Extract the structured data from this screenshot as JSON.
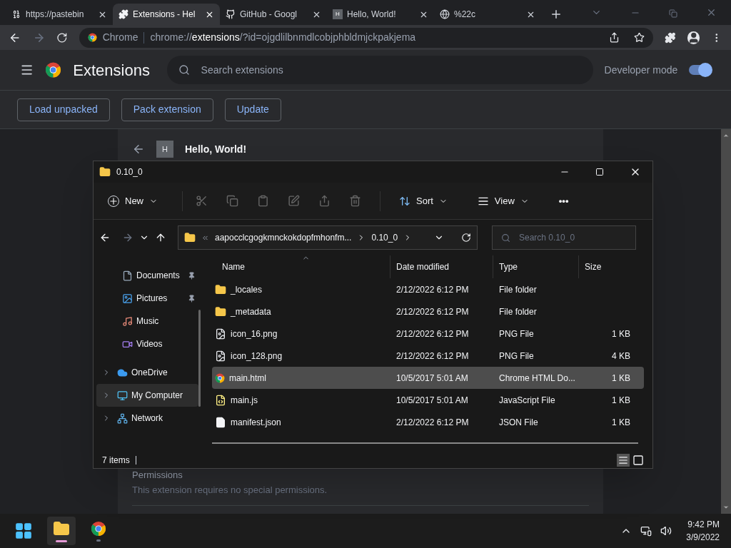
{
  "tabs": [
    {
      "kind": "binary",
      "title": "https://pastebin",
      "selected": false
    },
    {
      "kind": "puzzle",
      "title": "Extensions - Hel",
      "selected": true
    },
    {
      "kind": "github",
      "title": "GitHub - Googl",
      "selected": false
    },
    {
      "kind": "letter",
      "badge": "H",
      "title": "Hello, World!",
      "selected": false
    },
    {
      "kind": "globe",
      "title": "%22c",
      "selected": false
    }
  ],
  "omnibox": {
    "chip": "Chrome",
    "url_prefix": "chrome://",
    "url_host": "extensions",
    "url_rest": "/?id=ojgdlilbnmdlcobjphbldmjckpakjema"
  },
  "extensions_header": {
    "title": "Extensions",
    "search_placeholder": "Search extensions",
    "developer_mode_label": "Developer mode",
    "developer_mode_on": true
  },
  "dev_buttons": [
    "Load unpacked",
    "Pack extension",
    "Update"
  ],
  "extension_card": {
    "badge": "H",
    "name": "Hello, World!",
    "section_title": "Permissions",
    "section_text": "This extension requires no special permissions."
  },
  "explorer": {
    "title": "0.10_0",
    "commands": [
      {
        "kind": "new",
        "label": "New"
      },
      {
        "kind": "cut"
      },
      {
        "kind": "copy"
      },
      {
        "kind": "paste"
      },
      {
        "kind": "rename"
      },
      {
        "kind": "share"
      },
      {
        "kind": "delete"
      },
      {
        "kind": "sort",
        "label": "Sort"
      },
      {
        "kind": "view",
        "label": "View"
      },
      {
        "kind": "more",
        "label": "•••"
      }
    ],
    "breadcrumb": [
      "aapocclcgogkmnckokdopfmhonfm...",
      "0.10_0"
    ],
    "search_placeholder": "Search 0.10_0",
    "nav": [
      {
        "kind": "documents",
        "label": "Documents",
        "pinned": true,
        "expandable": false,
        "selected": false
      },
      {
        "kind": "pictures",
        "label": "Pictures",
        "pinned": true,
        "expandable": false,
        "selected": false
      },
      {
        "kind": "music",
        "label": "Music",
        "pinned": false,
        "expandable": false,
        "selected": false
      },
      {
        "kind": "videos",
        "label": "Videos",
        "pinned": false,
        "expandable": false,
        "selected": false
      },
      {
        "kind": "onedrive",
        "label": "OneDrive",
        "pinned": false,
        "expandable": true,
        "selected": false
      },
      {
        "kind": "computer",
        "label": "My Computer",
        "pinned": false,
        "expandable": true,
        "selected": true
      },
      {
        "kind": "network",
        "label": "Network",
        "pinned": false,
        "expandable": true,
        "selected": false
      }
    ],
    "columns": [
      "Name",
      "Date modified",
      "Type",
      "Size"
    ],
    "rows": [
      {
        "kind": "folder",
        "name": "_locales",
        "date": "2/12/2022 6:12 PM",
        "type": "File folder",
        "selected": false
      },
      {
        "kind": "folder",
        "name": "_metadata",
        "date": "2/12/2022 6:12 PM",
        "type": "File folder",
        "selected": false
      },
      {
        "kind": "image",
        "name": "icon_16.png",
        "date": "2/12/2022 6:12 PM",
        "type": "PNG File",
        "size": "1 KB",
        "selected": false
      },
      {
        "kind": "image",
        "name": "icon_128.png",
        "date": "2/12/2022 6:12 PM",
        "type": "PNG File",
        "size": "4 KB",
        "selected": false
      },
      {
        "kind": "chrome",
        "name": "main.html",
        "date": "10/5/2017 5:01 AM",
        "type": "Chrome HTML Do...",
        "size": "1 KB",
        "selected": true
      },
      {
        "kind": "script",
        "name": "main.js",
        "date": "10/5/2017 5:01 AM",
        "type": "JavaScript File",
        "size": "1 KB",
        "selected": false
      },
      {
        "kind": "file",
        "name": "manifest.json",
        "date": "2/12/2022 6:12 PM",
        "type": "JSON File",
        "size": "1 KB",
        "selected": false
      }
    ],
    "status": "7 items"
  },
  "taskbar": {
    "apps": [
      {
        "kind": "explorer",
        "active": true
      },
      {
        "kind": "chrome",
        "active": false
      }
    ],
    "time": "9:42 PM",
    "date": "3/9/2022"
  }
}
